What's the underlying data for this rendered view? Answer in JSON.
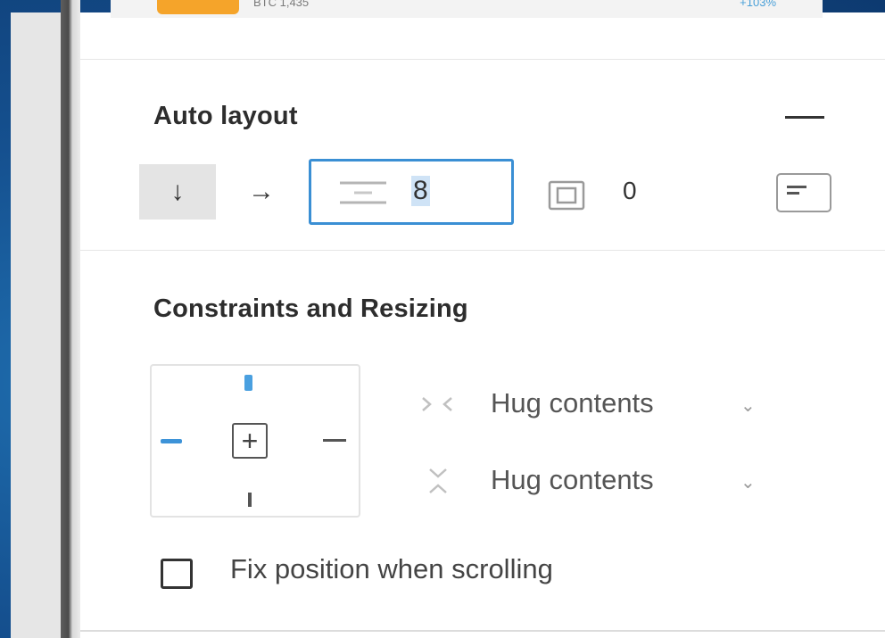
{
  "top_strip": {
    "coin_text": "BTC 1,435",
    "delta_text": "+103%"
  },
  "auto_layout": {
    "title": "Auto layout",
    "direction_vertical_glyph": "↓",
    "direction_horizontal_glyph": "→",
    "spacing_value": "8",
    "padding_value": "0",
    "icons": [
      "collapse-icon",
      "arrow-down-icon",
      "arrow-right-icon",
      "spacing-between-icon",
      "padding-icon",
      "alignment-icon"
    ]
  },
  "constraints": {
    "title": "Constraints and Resizing",
    "center_glyph": "+",
    "width_mode": "Hug contents",
    "height_mode": "Hug contents",
    "chevron_glyph": "⌄",
    "fix_position_label": "Fix position when scrolling",
    "fix_position_checked": false
  },
  "colors": {
    "accent": "#3a8fd4",
    "background": "#15508f",
    "panel": "#ffffff",
    "sidebar": "#e6e6e6"
  }
}
